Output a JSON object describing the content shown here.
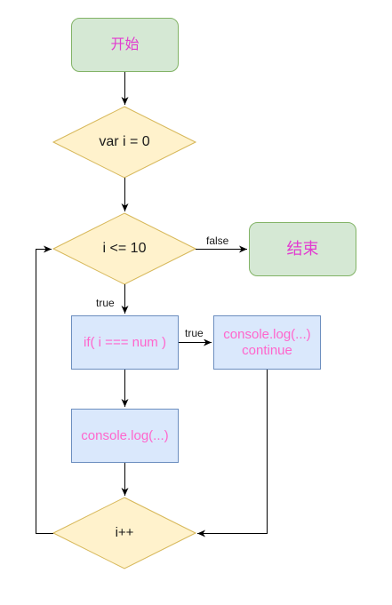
{
  "nodes": {
    "start": "开始",
    "init": "var i = 0",
    "condition": "i <= 10",
    "end": "结束",
    "check": "if( i === num )",
    "continue_line1": "console.log(...)",
    "continue_line2": "continue",
    "log": "console.log(...)",
    "increment": "i++"
  },
  "edges": {
    "false_label": "false",
    "true_label_down": "true",
    "true_label_right": "true"
  },
  "colors": {
    "terminal_fill": "#d5e8d4",
    "terminal_stroke": "#82b366",
    "decision_fill": "#fff2cc",
    "decision_stroke": "#d6b656",
    "process_fill": "#dae8fc",
    "process_stroke": "#6c8ebf",
    "text_pink": "#ff66cc"
  }
}
